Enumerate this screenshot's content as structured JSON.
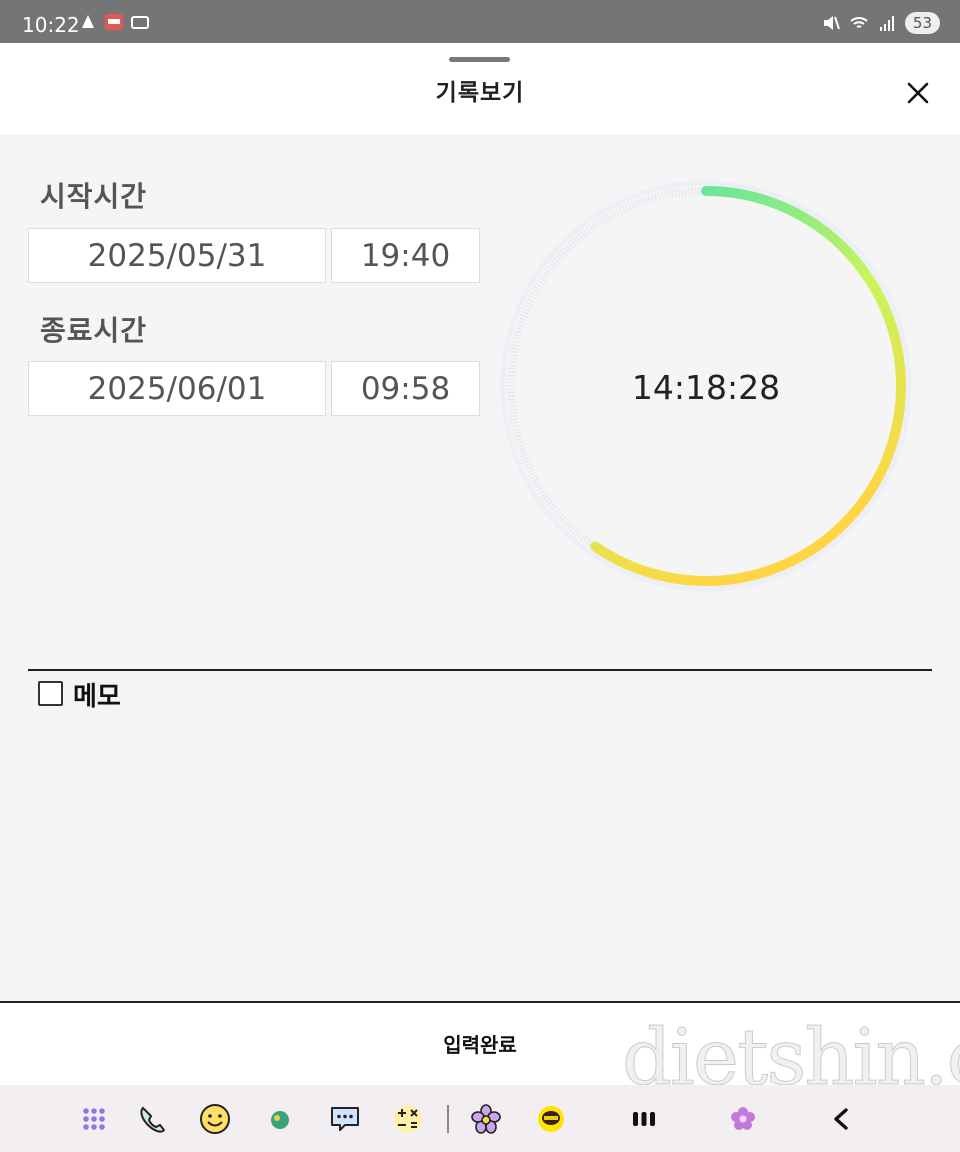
{
  "status_bar": {
    "time": "10:22",
    "battery": "53"
  },
  "header": {
    "title": "기록보기"
  },
  "start": {
    "label": "시작시간",
    "date": "2025/05/31",
    "time": "19:40"
  },
  "end": {
    "label": "종료시간",
    "date": "2025/06/01",
    "time": "09:58"
  },
  "duration": {
    "text": "14:18:28",
    "progress": 0.596
  },
  "memo": {
    "label": "메모",
    "checked": false
  },
  "submit": {
    "label": "입력완료"
  },
  "watermark": "dietshin.com",
  "nav": {
    "apps": [
      "apps-grid-icon",
      "phone-icon",
      "smiley-icon",
      "app-icon",
      "chat-icon",
      "calculator-icon",
      "flower-app-icon",
      "kakaotalk-icon"
    ],
    "system": [
      "recent-apps-icon",
      "home-icon",
      "back-icon"
    ]
  },
  "colors": {
    "accent_start": "#4de0b0",
    "accent_mid": "#c8f55a",
    "accent_end": "#ffd545",
    "status_bar": "#757575"
  }
}
